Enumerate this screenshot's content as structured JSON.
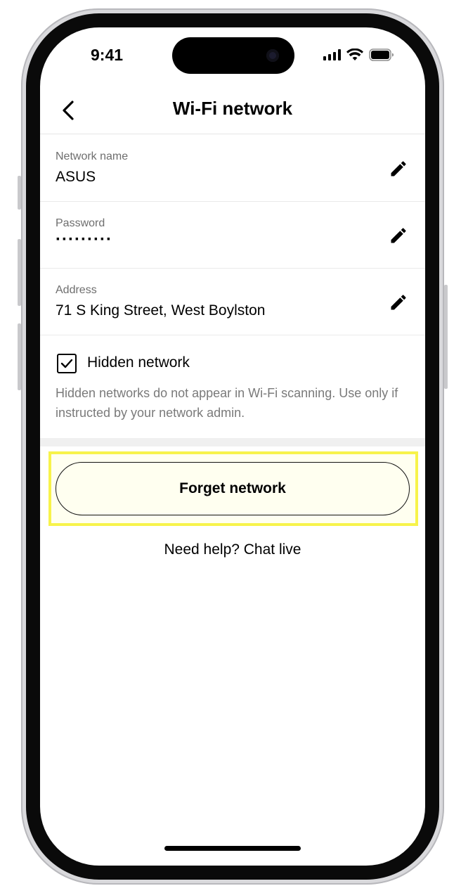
{
  "status_bar": {
    "time": "9:41"
  },
  "header": {
    "title": "Wi-Fi network"
  },
  "network": {
    "name_label": "Network name",
    "name_value": "ASUS",
    "password_label": "Password",
    "password_value": "·········",
    "address_label": "Address",
    "address_value": "71 S King Street, West Boylston"
  },
  "hidden": {
    "label": "Hidden network",
    "checked": true,
    "hint": "Hidden networks do not appear in Wi-Fi scanning. Use only if instructed by your network admin."
  },
  "actions": {
    "forget_label": "Forget network",
    "help_label": "Need help? Chat live"
  },
  "colors": {
    "highlight_border": "#f7f34a",
    "button_fill": "#fffff0",
    "muted_text": "#6e6e6e"
  },
  "icons": [
    "back-chevron-icon",
    "edit-pencil-icon",
    "checkmark-icon",
    "signal-icon",
    "wifi-icon",
    "battery-icon"
  ]
}
